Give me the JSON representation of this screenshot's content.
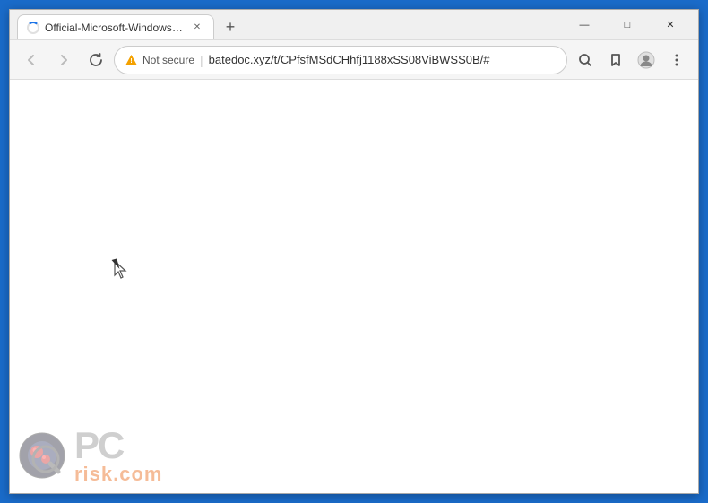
{
  "window": {
    "title": "Official-Microsoft-Windows-Help",
    "tab_title": "Official-Microsoft-Windows-Helk",
    "url": "batedoc.xyz/t/CPfsfMSdCHhfj1188xSS08ViBWSS0B/#",
    "security_label": "Not secure",
    "new_tab_symbol": "+",
    "controls": {
      "minimize": "—",
      "maximize": "□",
      "close": "✕"
    }
  },
  "nav": {
    "back_title": "back",
    "forward_title": "forward",
    "reload_title": "reload",
    "search_title": "search",
    "bookmark_title": "bookmark",
    "profile_title": "profile",
    "menu_title": "menu"
  },
  "watermark": {
    "pc_text": "PC",
    "risk_text": "risk.com"
  }
}
